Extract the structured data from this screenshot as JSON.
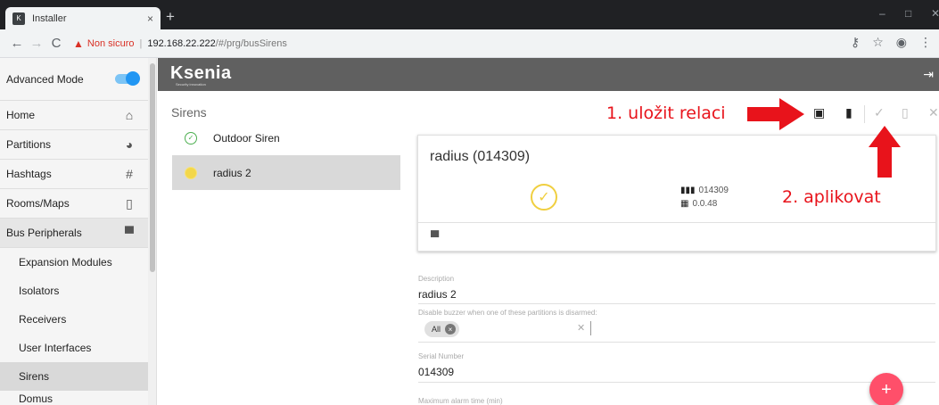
{
  "browser": {
    "tab_title": "Installer",
    "tab_favicon": "ksenia",
    "tab_close": "×",
    "new_tab": "+",
    "not_secure": "Non sicuro",
    "host": "192.168.22.222",
    "path": "/#/prg/busSirens"
  },
  "sidebar": {
    "advanced_mode_label": "Advanced Mode",
    "advanced_mode_on": true,
    "items": [
      {
        "label": "Home",
        "icon": "home-icon"
      },
      {
        "label": "Partitions",
        "icon": "pie-chart-icon"
      },
      {
        "label": "Hashtags",
        "icon": "hashtag-icon"
      },
      {
        "label": "Rooms/Maps",
        "icon": "door-icon"
      },
      {
        "label": "Bus Peripherals",
        "icon": "monitor-icon"
      }
    ],
    "sub_items": [
      {
        "label": "Expansion Modules"
      },
      {
        "label": "Isolators"
      },
      {
        "label": "Receivers"
      },
      {
        "label": "User Interfaces"
      },
      {
        "label": "Sirens"
      },
      {
        "label": "Domus"
      }
    ]
  },
  "header": {
    "logo": "Ksenia",
    "logo_sub": "Security innovation"
  },
  "page": {
    "title": "Sirens"
  },
  "devices": [
    {
      "label": "Outdoor Siren",
      "status": "ok"
    },
    {
      "label": "radius 2",
      "status": "warning"
    }
  ],
  "card": {
    "title": "radius (014309)",
    "serial": "014309",
    "firmware": "0.0.48"
  },
  "form": {
    "description_label": "Description",
    "description_value": "radius 2",
    "buzzer_label": "Disable buzzer when one of these partitions is disarmed:",
    "buzzer_chip": "All",
    "serial_label": "Serial Number",
    "serial_value": "014309",
    "max_alarm_label": "Maximum alarm time (min)"
  },
  "annotations": {
    "save_session": "1. uložit relaci",
    "apply": "2. aplikovat"
  },
  "colors": {
    "accent_blue": "#2196f3",
    "fab_pink": "#ff4f6a",
    "annotation_red": "#e8131b",
    "status_green": "#4caf50",
    "status_yellow": "#f0cf40"
  }
}
